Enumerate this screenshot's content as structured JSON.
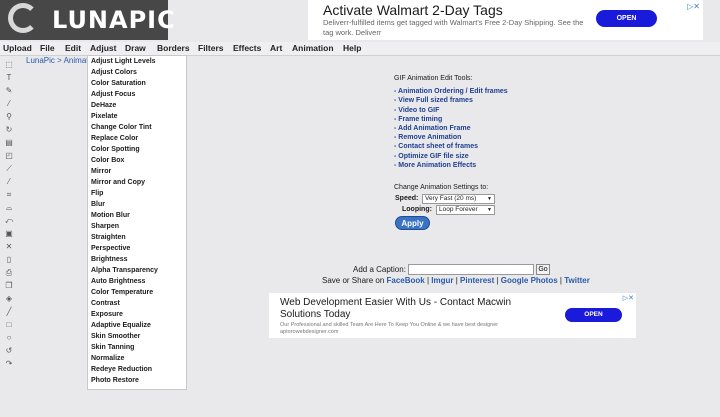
{
  "logo": {
    "text": "LUNAPIC"
  },
  "top_ad": {
    "title": "Activate Walmart 2-Day Tags",
    "subtitle": "Deliverr-fulfilled items get tagged with Walmart's Free 2-Day Shipping. See the tag work. Deliverr",
    "button": "OPEN"
  },
  "menu": [
    "Upload",
    "File",
    "Edit",
    "Adjust",
    "Draw",
    "Borders",
    "Filters",
    "Effects",
    "Art",
    "Animation",
    "Help"
  ],
  "breadcrumb": "LunaPic > Animat",
  "adjust_menu": [
    "Adjust Light Levels",
    "Adjust Colors",
    "Color Saturation",
    "Adjust Focus",
    "DeHaze",
    "Pixelate",
    "Change Color Tint",
    "Replace Color",
    "Color Spotting",
    "Color Box",
    "Mirror",
    "Mirror and Copy",
    "Flip",
    "Blur",
    "Motion Blur",
    "Sharpen",
    "Straighten",
    "Perspective",
    "Brightness",
    "Alpha Transparency",
    "Auto Brightness",
    "Color Temperature",
    "Contrast",
    "Exposure",
    "Adaptive Equalize",
    "Skin Smoother",
    "Skin Tanning",
    "Normalize",
    "Redeye Reduction",
    "Photo Restore"
  ],
  "animation_tools": {
    "heading": "GIF Animation Edit Tools:",
    "links": [
      "- Animation Ordering / Edit frames",
      "- View Full sized frames",
      "- Video to GIF",
      "- Frame timing",
      "- Add Animation Frame",
      "- Remove Animation",
      "- Contact sheet of frames",
      "- Optimize GIF file size",
      "- More Animation Effects"
    ]
  },
  "settings": {
    "heading": "Change Animation Settings to:",
    "speed_label": "Speed:",
    "speed_value": "Very Fast (20 ms)",
    "looping_label": "Looping:",
    "looping_value": "Loop Forever",
    "apply": "Apply"
  },
  "caption": {
    "label": "Add a Caption:",
    "go": "Go"
  },
  "share": {
    "prefix": "Save or Share on",
    "facebook": "FaceBook",
    "imgur": "Imgur",
    "pinterest": "Pinterest",
    "google": "Google Photos",
    "twitter": "Twitter"
  },
  "bottom_ad": {
    "title": "Web Development Easier With Us - Contact Macwin Solutions Today",
    "subtitle": "Our Professional and skilled Team Are Here To Keep You Online & we have best designer",
    "domain": "aptorowebdesigner.com",
    "button": "OPEN"
  },
  "colors": {
    "accent": "#2a5aa8",
    "ad_button": "#1a1adb",
    "logo_bg": "#474747",
    "page_bg": "#e9e9ec"
  },
  "toolbar_icons": [
    "select-icon",
    "text-icon",
    "pencil-icon",
    "brush-icon",
    "zoom-icon",
    "rotate-icon",
    "fill-icon",
    "eraser-icon",
    "eyedropper-icon",
    "pen-icon",
    "crop-icon",
    "paint-icon",
    "undo-icon",
    "save-icon",
    "cut-icon",
    "new-icon",
    "print-icon",
    "copy-icon",
    "layers-icon",
    "line-icon",
    "rectangle-icon",
    "circle-icon",
    "refresh-icon",
    "redo-icon"
  ]
}
